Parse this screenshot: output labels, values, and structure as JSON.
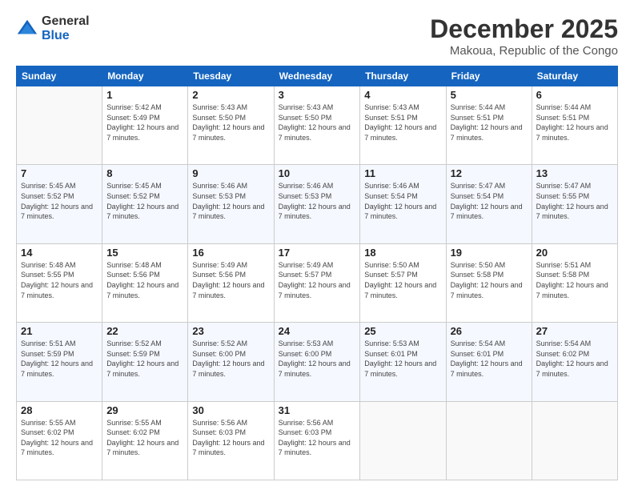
{
  "logo": {
    "general": "General",
    "blue": "Blue"
  },
  "header": {
    "month": "December 2025",
    "location": "Makoua, Republic of the Congo"
  },
  "weekdays": [
    "Sunday",
    "Monday",
    "Tuesday",
    "Wednesday",
    "Thursday",
    "Friday",
    "Saturday"
  ],
  "weeks": [
    [
      {
        "day": "",
        "sunrise": "",
        "sunset": "",
        "daylight": ""
      },
      {
        "day": "1",
        "sunrise": "Sunrise: 5:42 AM",
        "sunset": "Sunset: 5:49 PM",
        "daylight": "Daylight: 12 hours and 7 minutes."
      },
      {
        "day": "2",
        "sunrise": "Sunrise: 5:43 AM",
        "sunset": "Sunset: 5:50 PM",
        "daylight": "Daylight: 12 hours and 7 minutes."
      },
      {
        "day": "3",
        "sunrise": "Sunrise: 5:43 AM",
        "sunset": "Sunset: 5:50 PM",
        "daylight": "Daylight: 12 hours and 7 minutes."
      },
      {
        "day": "4",
        "sunrise": "Sunrise: 5:43 AM",
        "sunset": "Sunset: 5:51 PM",
        "daylight": "Daylight: 12 hours and 7 minutes."
      },
      {
        "day": "5",
        "sunrise": "Sunrise: 5:44 AM",
        "sunset": "Sunset: 5:51 PM",
        "daylight": "Daylight: 12 hours and 7 minutes."
      },
      {
        "day": "6",
        "sunrise": "Sunrise: 5:44 AM",
        "sunset": "Sunset: 5:51 PM",
        "daylight": "Daylight: 12 hours and 7 minutes."
      }
    ],
    [
      {
        "day": "7",
        "sunrise": "Sunrise: 5:45 AM",
        "sunset": "Sunset: 5:52 PM",
        "daylight": "Daylight: 12 hours and 7 minutes."
      },
      {
        "day": "8",
        "sunrise": "Sunrise: 5:45 AM",
        "sunset": "Sunset: 5:52 PM",
        "daylight": "Daylight: 12 hours and 7 minutes."
      },
      {
        "day": "9",
        "sunrise": "Sunrise: 5:46 AM",
        "sunset": "Sunset: 5:53 PM",
        "daylight": "Daylight: 12 hours and 7 minutes."
      },
      {
        "day": "10",
        "sunrise": "Sunrise: 5:46 AM",
        "sunset": "Sunset: 5:53 PM",
        "daylight": "Daylight: 12 hours and 7 minutes."
      },
      {
        "day": "11",
        "sunrise": "Sunrise: 5:46 AM",
        "sunset": "Sunset: 5:54 PM",
        "daylight": "Daylight: 12 hours and 7 minutes."
      },
      {
        "day": "12",
        "sunrise": "Sunrise: 5:47 AM",
        "sunset": "Sunset: 5:54 PM",
        "daylight": "Daylight: 12 hours and 7 minutes."
      },
      {
        "day": "13",
        "sunrise": "Sunrise: 5:47 AM",
        "sunset": "Sunset: 5:55 PM",
        "daylight": "Daylight: 12 hours and 7 minutes."
      }
    ],
    [
      {
        "day": "14",
        "sunrise": "Sunrise: 5:48 AM",
        "sunset": "Sunset: 5:55 PM",
        "daylight": "Daylight: 12 hours and 7 minutes."
      },
      {
        "day": "15",
        "sunrise": "Sunrise: 5:48 AM",
        "sunset": "Sunset: 5:56 PM",
        "daylight": "Daylight: 12 hours and 7 minutes."
      },
      {
        "day": "16",
        "sunrise": "Sunrise: 5:49 AM",
        "sunset": "Sunset: 5:56 PM",
        "daylight": "Daylight: 12 hours and 7 minutes."
      },
      {
        "day": "17",
        "sunrise": "Sunrise: 5:49 AM",
        "sunset": "Sunset: 5:57 PM",
        "daylight": "Daylight: 12 hours and 7 minutes."
      },
      {
        "day": "18",
        "sunrise": "Sunrise: 5:50 AM",
        "sunset": "Sunset: 5:57 PM",
        "daylight": "Daylight: 12 hours and 7 minutes."
      },
      {
        "day": "19",
        "sunrise": "Sunrise: 5:50 AM",
        "sunset": "Sunset: 5:58 PM",
        "daylight": "Daylight: 12 hours and 7 minutes."
      },
      {
        "day": "20",
        "sunrise": "Sunrise: 5:51 AM",
        "sunset": "Sunset: 5:58 PM",
        "daylight": "Daylight: 12 hours and 7 minutes."
      }
    ],
    [
      {
        "day": "21",
        "sunrise": "Sunrise: 5:51 AM",
        "sunset": "Sunset: 5:59 PM",
        "daylight": "Daylight: 12 hours and 7 minutes."
      },
      {
        "day": "22",
        "sunrise": "Sunrise: 5:52 AM",
        "sunset": "Sunset: 5:59 PM",
        "daylight": "Daylight: 12 hours and 7 minutes."
      },
      {
        "day": "23",
        "sunrise": "Sunrise: 5:52 AM",
        "sunset": "Sunset: 6:00 PM",
        "daylight": "Daylight: 12 hours and 7 minutes."
      },
      {
        "day": "24",
        "sunrise": "Sunrise: 5:53 AM",
        "sunset": "Sunset: 6:00 PM",
        "daylight": "Daylight: 12 hours and 7 minutes."
      },
      {
        "day": "25",
        "sunrise": "Sunrise: 5:53 AM",
        "sunset": "Sunset: 6:01 PM",
        "daylight": "Daylight: 12 hours and 7 minutes."
      },
      {
        "day": "26",
        "sunrise": "Sunrise: 5:54 AM",
        "sunset": "Sunset: 6:01 PM",
        "daylight": "Daylight: 12 hours and 7 minutes."
      },
      {
        "day": "27",
        "sunrise": "Sunrise: 5:54 AM",
        "sunset": "Sunset: 6:02 PM",
        "daylight": "Daylight: 12 hours and 7 minutes."
      }
    ],
    [
      {
        "day": "28",
        "sunrise": "Sunrise: 5:55 AM",
        "sunset": "Sunset: 6:02 PM",
        "daylight": "Daylight: 12 hours and 7 minutes."
      },
      {
        "day": "29",
        "sunrise": "Sunrise: 5:55 AM",
        "sunset": "Sunset: 6:02 PM",
        "daylight": "Daylight: 12 hours and 7 minutes."
      },
      {
        "day": "30",
        "sunrise": "Sunrise: 5:56 AM",
        "sunset": "Sunset: 6:03 PM",
        "daylight": "Daylight: 12 hours and 7 minutes."
      },
      {
        "day": "31",
        "sunrise": "Sunrise: 5:56 AM",
        "sunset": "Sunset: 6:03 PM",
        "daylight": "Daylight: 12 hours and 7 minutes."
      },
      {
        "day": "",
        "sunrise": "",
        "sunset": "",
        "daylight": ""
      },
      {
        "day": "",
        "sunrise": "",
        "sunset": "",
        "daylight": ""
      },
      {
        "day": "",
        "sunrise": "",
        "sunset": "",
        "daylight": ""
      }
    ]
  ]
}
